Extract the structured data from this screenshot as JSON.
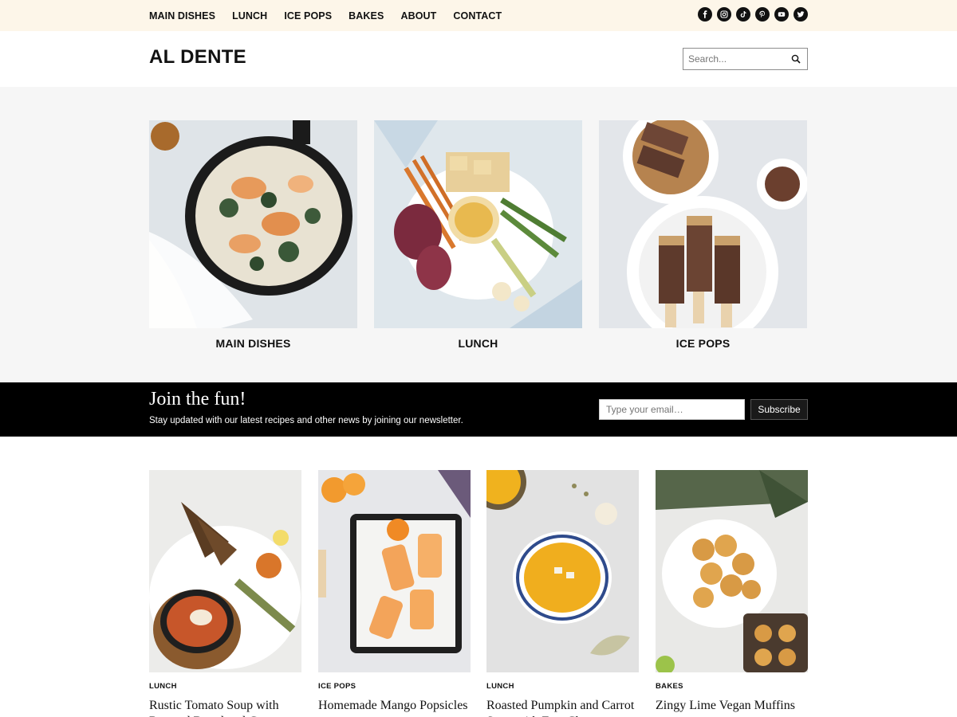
{
  "topnav": {
    "items": [
      "MAIN DISHES",
      "LUNCH",
      "ICE POPS",
      "BAKES",
      "ABOUT",
      "CONTACT"
    ]
  },
  "social": {
    "icons": [
      "facebook-icon",
      "instagram-icon",
      "tiktok-icon",
      "pinterest-icon",
      "youtube-icon",
      "twitter-icon"
    ]
  },
  "header": {
    "brand": "AL DENTE",
    "search_placeholder": "Search..."
  },
  "categories": [
    {
      "label": "MAIN DISHES"
    },
    {
      "label": "LUNCH"
    },
    {
      "label": "ICE POPS"
    }
  ],
  "newsletter": {
    "title": "Join the fun!",
    "subtitle": "Stay updated with our latest recipes and other news by joining our newsletter.",
    "email_placeholder": "Type your email…",
    "button": "Subscribe"
  },
  "posts": [
    {
      "category": "LUNCH",
      "title": "Rustic Tomato Soup with Roasted Bread and Goat Dough"
    },
    {
      "category": "ICE POPS",
      "title": "Homemade Mango Popsicles"
    },
    {
      "category": "LUNCH",
      "title": "Roasted Pumpkin and Carrot Soup with Feta Cheese"
    },
    {
      "category": "BAKES",
      "title": "Zingy Lime Vegan Muffins"
    }
  ],
  "colors": {
    "topbar_bg": "#fdf6e9",
    "categories_bg": "#f6f6f6",
    "newsletter_bg": "#000000"
  }
}
